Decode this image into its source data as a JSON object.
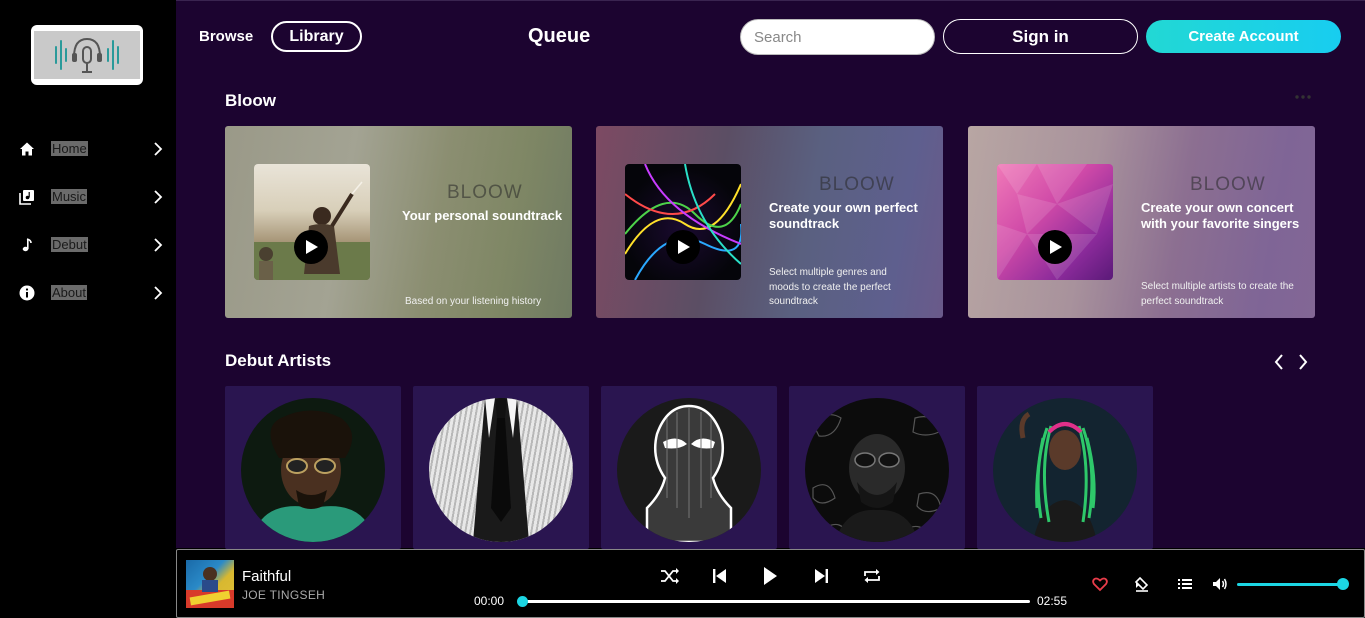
{
  "sidebar": {
    "items": [
      {
        "label": "Home",
        "icon": "home-icon"
      },
      {
        "label": "Music",
        "icon": "music-library-icon"
      },
      {
        "label": "Debut",
        "icon": "music-note-icon"
      },
      {
        "label": "About",
        "icon": "info-icon"
      }
    ]
  },
  "header": {
    "browse": "Browse",
    "library": "Library",
    "title": "Queue",
    "search_placeholder": "Search",
    "sign_in": "Sign in",
    "create_account": "Create Account"
  },
  "bloow_section": {
    "title": "Bloow",
    "cards": [
      {
        "brand": "BLOOW",
        "heading": "Your personal soundtrack",
        "description": "Based on your listening history"
      },
      {
        "brand": "BLOOW",
        "heading": "Create your own perfect soundtrack",
        "description": "Select multiple genres and moods to create the perfect soundtrack"
      },
      {
        "brand": "BLOOW",
        "heading": "Create your own concert with your favorite singers",
        "description": "Select multiple artists to create the perfect soundtrack"
      }
    ]
  },
  "debut_section": {
    "title": "Debut Artists"
  },
  "player": {
    "song": "Faithful",
    "artist": "JOE TINGSEH",
    "current_time": "00:00",
    "duration": "02:55",
    "progress": 0.0,
    "volume": 1.0,
    "liked": true
  },
  "colors": {
    "accent": "#1cd6e4",
    "background": "#1c0430",
    "artist_card": "#2a1550",
    "like": "#e83c4a"
  }
}
